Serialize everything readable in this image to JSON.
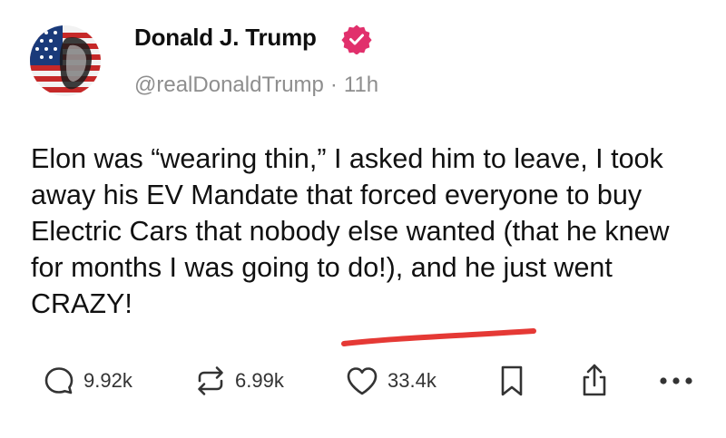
{
  "post": {
    "author": {
      "name": "Donald J. Trump",
      "handle": "@realDonaldTrump",
      "separator": "·",
      "time": "11h",
      "verified_icon": "verified-badge-icon",
      "verified_color": "#E1306C"
    },
    "text": "Elon was “wearing thin,” I asked him to leave, I took away his EV Mandate that forced everyone to buy Electric Cars that nobody else wanted (that he knew for months I was going to do!), and he just went CRAZY!",
    "annotation_color": "#e53935"
  },
  "actions": {
    "replies": {
      "icon": "comment-icon",
      "count": "9.92k"
    },
    "reposts": {
      "icon": "repost-icon",
      "count": "6.99k"
    },
    "likes": {
      "icon": "heart-icon",
      "count": "33.4k"
    },
    "save": {
      "icon": "bookmark-icon"
    },
    "share": {
      "icon": "share-icon"
    },
    "more": {
      "icon": "more-icon"
    }
  }
}
